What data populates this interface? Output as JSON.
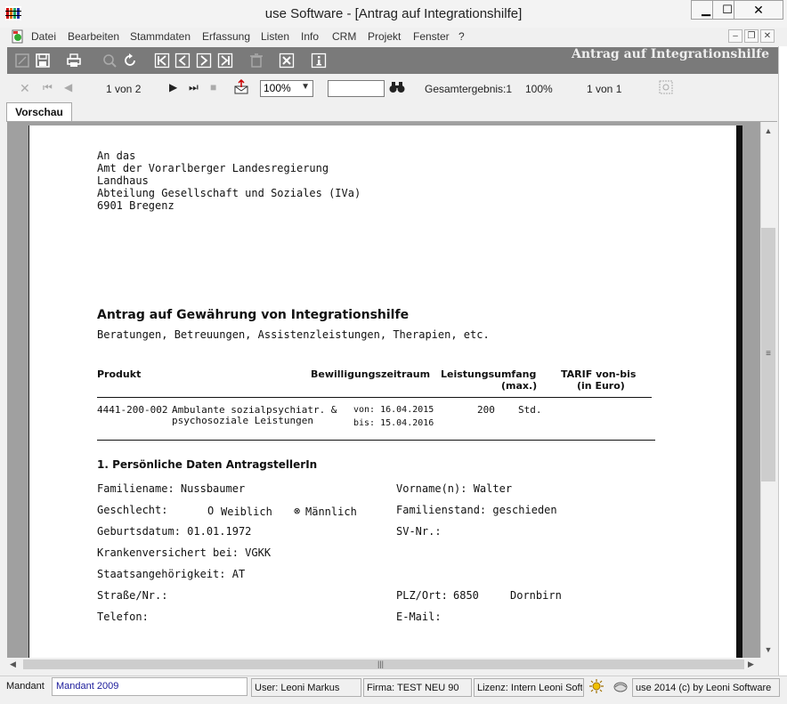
{
  "window": {
    "title": "use Software - [Antrag auf Integrationshilfe]",
    "min": "▁",
    "max": "☐",
    "close": "✕"
  },
  "menu": {
    "items": [
      "Datei",
      "Bearbeiten",
      "Stammdaten",
      "Erfassung",
      "Listen",
      "Info",
      "CRM",
      "Projekt",
      "Fenster",
      "?"
    ],
    "mdi_min": "–",
    "mdi_restore": "❐",
    "mdi_close": "✕"
  },
  "toolbar": {
    "heading": "Antrag auf Integrationshilfe",
    "icons": [
      "edit-icon",
      "save-icon",
      "print-icon",
      "search-icon",
      "refresh-icon",
      "first-record-icon",
      "prev-record-icon",
      "next-record-icon",
      "last-record-icon",
      "delete-icon",
      "close-icon",
      "info-icon"
    ]
  },
  "preview_toolbar": {
    "page_indicator": "1 von 2",
    "zoom": "100%",
    "search_value": "",
    "total": "Gesamtergebnis:1",
    "percent": "100%",
    "result_pages": "1 von 1"
  },
  "tabs": {
    "vorschau": "Vorschau"
  },
  "document": {
    "address": [
      "An das",
      "Amt der Vorarlberger Landesregierung",
      "Landhaus",
      "Abteilung Gesellschaft und Soziales (IVa)",
      "6901 Bregenz"
    ],
    "heading": "Antrag auf Gewährung von Integrationshilfe",
    "subheading": "Beratungen, Betreuungen, Assistenzleistungen, Therapien, etc.",
    "table": {
      "col_produkt": "Produkt",
      "col_zeitraum": "Bewilligungszeitraum",
      "col_umfang_1": "Leistungsumfang",
      "col_umfang_2": "(max.)",
      "col_tarif_1": "TARIF von-bis",
      "col_tarif_2": "(in Euro)",
      "row": {
        "code": "4441-200-002",
        "desc_1": "Ambulante sozialpsychiatr. &",
        "desc_2": "psychosoziale Leistungen",
        "von": "von: 16.04.2015",
        "bis": "bis: 15.04.2016",
        "amount": "200",
        "unit": "Std."
      }
    },
    "section1_title": "1. Persönliche Daten AntragstellerIn",
    "fields": {
      "familienname": "Familiename: Nussbaumer",
      "vorname": "Vorname(n): Walter",
      "geschlecht": "Geschlecht:",
      "weiblich_mark": "O",
      "weiblich": "Weiblich",
      "maennlich_mark": "⊗",
      "maennlich": "Männlich",
      "familienstand": "Familienstand: geschieden",
      "geburtsdatum": "Geburtsdatum: 01.01.1972",
      "svnr": "SV-Nr.:",
      "kranken": "Krankenversichert bei: VGKK",
      "staat": "Staatsangehörigkeit: AT",
      "strasse": "Straße/Nr.:",
      "plz_label": "PLZ/Ort:",
      "plz": "6850",
      "ort": "Dornbirn",
      "telefon": "Telefon:",
      "email": "E-Mail:"
    }
  },
  "statusbar": {
    "mandant_label": "Mandant",
    "mandant_value": "Mandant 2009",
    "user": "User: Leoni Markus",
    "firma": "Firma: TEST NEU 90",
    "lizenz": "Lizenz: Intern Leoni Software",
    "copyright": "use 2014 (c) by Leoni Software"
  },
  "colors": {
    "toolbar_bg": "#7a7a7a",
    "preview_bg": "#a0a0a0",
    "mandant_text": "#1a1a9a"
  }
}
